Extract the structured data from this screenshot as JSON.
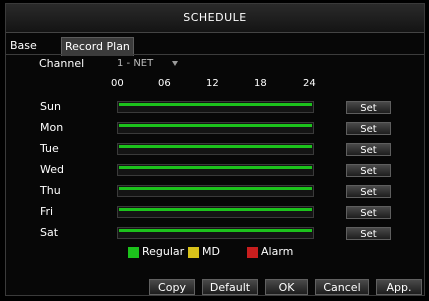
{
  "window": {
    "title": "SCHEDULE"
  },
  "tabs": [
    {
      "label": "Base"
    },
    {
      "label": "Record Plan"
    }
  ],
  "channel": {
    "label": "Channel",
    "value": "1 - NET"
  },
  "timeline": {
    "hours": [
      "00",
      "06",
      "12",
      "18",
      "24"
    ]
  },
  "days": [
    {
      "label": "Sun",
      "set": "Set",
      "regular_coverage": 1.0
    },
    {
      "label": "Mon",
      "set": "Set",
      "regular_coverage": 1.0
    },
    {
      "label": "Tue",
      "set": "Set",
      "regular_coverage": 1.0
    },
    {
      "label": "Wed",
      "set": "Set",
      "regular_coverage": 1.0
    },
    {
      "label": "Thu",
      "set": "Set",
      "regular_coverage": 1.0
    },
    {
      "label": "Fri",
      "set": "Set",
      "regular_coverage": 1.0
    },
    {
      "label": "Sat",
      "set": "Set",
      "regular_coverage": 1.0
    }
  ],
  "legend": [
    {
      "label": "Regular",
      "color": "#1cc21c"
    },
    {
      "label": "MD",
      "color": "#d8c21a"
    },
    {
      "label": "Alarm",
      "color": "#c81e1e"
    }
  ],
  "buttons": {
    "copy": "Copy",
    "default": "Default",
    "ok": "OK",
    "cancel": "Cancel",
    "apply": "App."
  }
}
